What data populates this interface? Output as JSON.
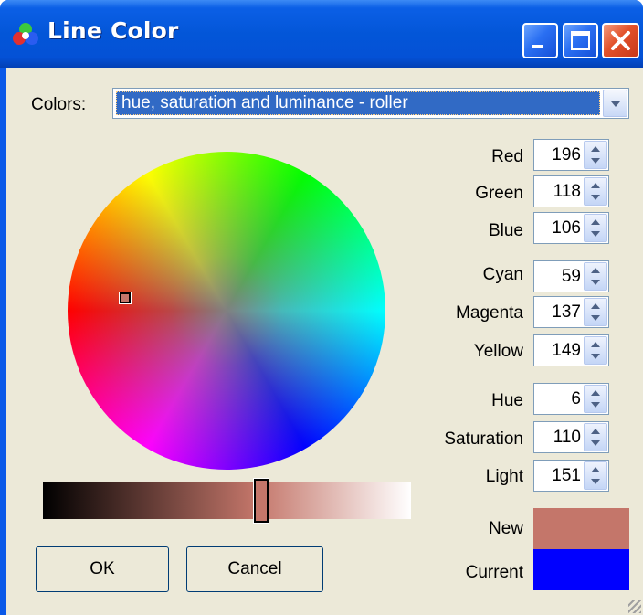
{
  "window": {
    "title": "Line Color",
    "icon": "color-palette-icon",
    "controls": [
      "minimize-icon",
      "maximize-icon",
      "close-icon"
    ]
  },
  "colors_row": {
    "label": "Colors:",
    "selected": "hue, saturation and luminance - roller"
  },
  "wheel": {
    "marker_color": "#c4766a"
  },
  "luminance_slider": {
    "value": 151,
    "max": 255
  },
  "fields": {
    "red": {
      "label": "Red",
      "value": "196"
    },
    "green": {
      "label": "Green",
      "value": "118"
    },
    "blue": {
      "label": "Blue",
      "value": "106"
    },
    "cyan": {
      "label": "Cyan",
      "value": "59"
    },
    "magenta": {
      "label": "Magenta",
      "value": "137"
    },
    "yellow": {
      "label": "Yellow",
      "value": "149"
    },
    "hue": {
      "label": "Hue",
      "value": "6"
    },
    "saturation": {
      "label": "Saturation",
      "value": "110"
    },
    "light": {
      "label": "Light",
      "value": "151"
    }
  },
  "preview": {
    "new_label": "New",
    "new_color": "#c4766a",
    "current_label": "Current",
    "current_color": "#0000ff"
  },
  "buttons": {
    "ok": "OK",
    "cancel": "Cancel"
  }
}
